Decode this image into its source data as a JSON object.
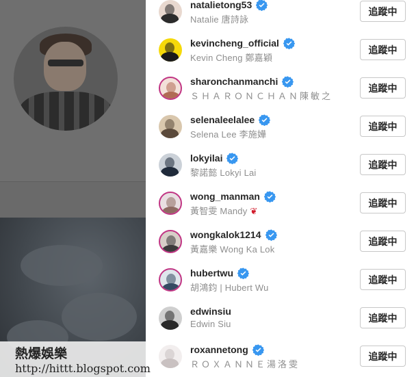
{
  "accent": "#3897f0",
  "story_ring_color": "#c13584",
  "following_list": {
    "button_label": "追蹤中",
    "accounts": [
      {
        "username": "natalietong53",
        "full_name": "Natalie 唐詩詠",
        "verified": true,
        "story_ring": false,
        "avatar": "natalietong53-avatar"
      },
      {
        "username": "kevincheng_official",
        "full_name": "Kevin Cheng 鄭嘉穎",
        "verified": true,
        "story_ring": false,
        "avatar": "kevincheng-avatar"
      },
      {
        "username": "sharonchanmanchi",
        "full_name": "ＳＨＡＲＯＮＣＨＡＮ陳敏之",
        "verified": true,
        "story_ring": true,
        "avatar": "sharonchan-avatar"
      },
      {
        "username": "selenaleelalee",
        "full_name": "Selena Lee 李施嬅",
        "verified": true,
        "story_ring": false,
        "avatar": "selenalee-avatar"
      },
      {
        "username": "lokyilai",
        "full_name": "黎諾懿 Lokyi Lai",
        "verified": true,
        "story_ring": false,
        "avatar": "lokyilai-avatar"
      },
      {
        "username": "wong_manman",
        "full_name": "黃智雯 Mandy",
        "verified": true,
        "story_ring": true,
        "avatar": "wongmanman-avatar",
        "emoji": "lips-icon"
      },
      {
        "username": "wongkalok1214",
        "full_name": "黃嘉樂 Wong Ka Lok",
        "verified": true,
        "story_ring": true,
        "avatar": "wongkalok-avatar"
      },
      {
        "username": "hubertwu",
        "full_name": "胡鴻鈞 | Hubert Wu",
        "verified": true,
        "story_ring": true,
        "avatar": "hubertwu-avatar"
      },
      {
        "username": "edwinsiu",
        "full_name": "Edwin Siu",
        "verified": false,
        "story_ring": false,
        "avatar": "edwinsiu-avatar"
      },
      {
        "username": "roxannetong",
        "full_name": "ＲＯＸＡＮＮＥ湯洛雯",
        "verified": true,
        "story_ring": false,
        "avatar": "roxannetong-avatar"
      }
    ]
  },
  "watermark": {
    "line1": "熱爆娛樂",
    "line2": "http://hittt.blogspot.com"
  }
}
